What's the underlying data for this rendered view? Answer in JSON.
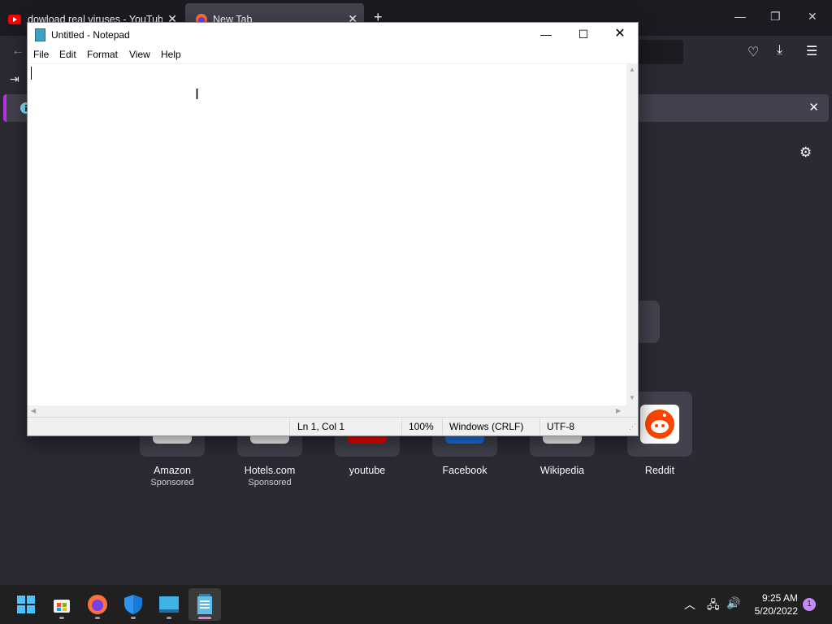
{
  "browser": {
    "tabs": [
      {
        "title": "dowload real viruses - YouTube",
        "icon": "youtube-icon"
      },
      {
        "title": "New Tab",
        "icon": "firefox-icon",
        "active": true
      }
    ],
    "infobar_icon": "info-icon",
    "top_sites": [
      {
        "label": "Amazon",
        "sponsor": "Sponsored"
      },
      {
        "label": "Hotels.com",
        "sponsor": "Sponsored"
      },
      {
        "label": "youtube",
        "sponsor": ""
      },
      {
        "label": "Facebook",
        "sponsor": ""
      },
      {
        "label": "Wikipedia",
        "sponsor": ""
      },
      {
        "label": "Reddit",
        "sponsor": ""
      }
    ],
    "colors": {
      "accent": "#b833e1",
      "reddit": "#ff4500"
    }
  },
  "notepad": {
    "title": "Untitled - Notepad",
    "menu": [
      "File",
      "Edit",
      "Format",
      "View",
      "Help"
    ],
    "content": "",
    "status": {
      "position": "Ln 1, Col 1",
      "zoom": "100%",
      "line_endings": "Windows (CRLF)",
      "encoding": "UTF-8"
    }
  },
  "taskbar": {
    "apps": [
      "windows-start-icon",
      "store-icon",
      "firefox-icon",
      "defender-icon",
      "remote-desktop-icon",
      "notepad-icon"
    ],
    "clock": {
      "time": "9:25 AM",
      "date": "5/20/2022"
    },
    "notification_count": "1"
  }
}
